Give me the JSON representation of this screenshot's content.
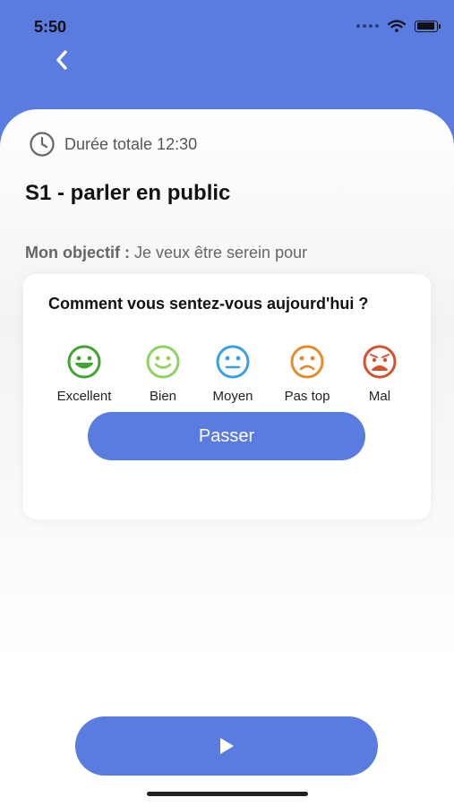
{
  "status_bar": {
    "time": "5:50"
  },
  "session": {
    "duration_label": "Durée totale 12:30",
    "title": "S1 - parler en public",
    "objective_label": "Mon objectif :",
    "objective_text": " Je veux être serein pour"
  },
  "mood_prompt": {
    "question": "Comment vous sentez-vous aujourd'hui ?",
    "options": [
      {
        "label": "Excellent",
        "color": "#3fa533"
      },
      {
        "label": "Bien",
        "color": "#8fd35f"
      },
      {
        "label": "Moyen",
        "color": "#3b9fe0"
      },
      {
        "label": "Pas top",
        "color": "#e68a2e"
      },
      {
        "label": "Mal",
        "color": "#d4532f"
      }
    ],
    "skip_label": "Passer"
  },
  "icons": {
    "back": "chevron-left-icon",
    "clock": "clock-icon",
    "play": "play-icon"
  },
  "colors": {
    "accent": "#5a7be0"
  }
}
